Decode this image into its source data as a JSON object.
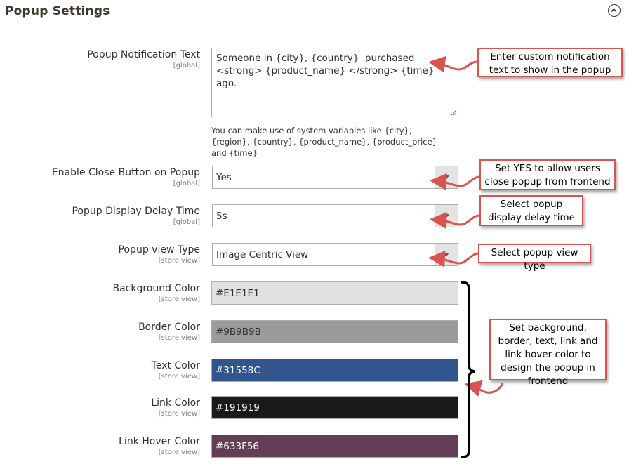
{
  "section": {
    "title": "Popup Settings",
    "collapse_icon": "chevron-up-circle-icon"
  },
  "fields": {
    "notification_text": {
      "label": "Popup Notification Text",
      "scope": "[global]",
      "value": "Someone in {city}, {country}  purchased <strong> {product_name} </strong> {time} ago.",
      "note": "You can make use of system variables like {city}, {region}, {country}, {product_name}, {product_price} and {time}"
    },
    "close_button": {
      "label": "Enable Close Button on Popup",
      "scope": "[global]",
      "value": "Yes"
    },
    "delay_time": {
      "label": "Popup Display Delay Time",
      "scope": "[global]",
      "value": "5s"
    },
    "view_type": {
      "label": "Popup view Type",
      "scope": "[store view]",
      "value": "Image Centric View"
    },
    "background_color": {
      "label": "Background Color",
      "scope": "[store view]",
      "value": "#E1E1E1",
      "color": "#E1E1E1",
      "text_color": "#303030"
    },
    "border_color": {
      "label": "Border Color",
      "scope": "[store view]",
      "value": "#9B9B9B",
      "color": "#9B9B9B",
      "text_color": "#303030"
    },
    "text_color": {
      "label": "Text Color",
      "scope": "[store view]",
      "value": "#31558C",
      "color": "#31558C",
      "text_color": "#ffffff"
    },
    "link_color": {
      "label": "Link Color",
      "scope": "[store view]",
      "value": "#191919",
      "color": "#191919",
      "text_color": "#ffffff"
    },
    "link_hover_color": {
      "label": "Link Hover Color",
      "scope": "[store view]",
      "value": "#633F56",
      "color": "#633F56",
      "text_color": "#ffffff"
    }
  },
  "callouts": {
    "notification": "Enter custom notification text to show in the popup",
    "close_button": "Set YES to allow users close popup from frontend",
    "delay": "Select popup display delay time",
    "view_type": "Select popup view type",
    "colors": "Set background, border, text, link and link hover color to design the popup in frontend"
  },
  "accent_colors": {
    "callout_border": "#d9534f",
    "arrow": "#d9534f"
  }
}
